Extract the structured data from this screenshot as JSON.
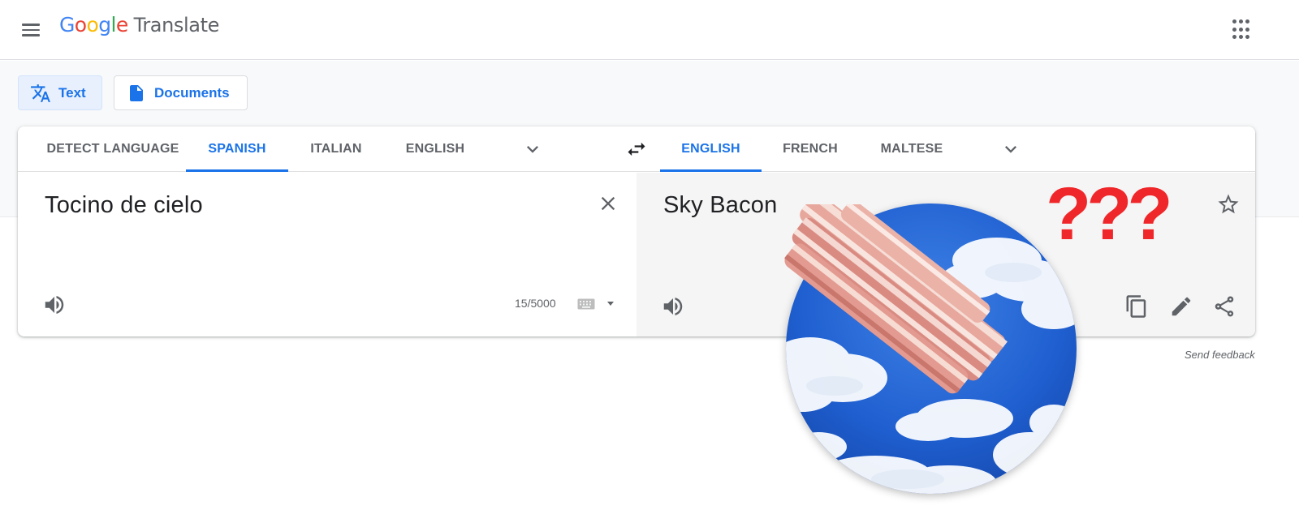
{
  "header": {
    "logo_letters": [
      "G",
      "o",
      "o",
      "g",
      "l",
      "e"
    ],
    "product_name": "Translate",
    "menu_icon": "hamburger-menu-icon",
    "apps_icon": "apps-grid-icon"
  },
  "modes": [
    {
      "label": "Text",
      "icon": "translate-icon",
      "selected": true
    },
    {
      "label": "Documents",
      "icon": "document-icon",
      "selected": false
    }
  ],
  "source_languages": [
    {
      "label": "DETECT LANGUAGE",
      "active": false
    },
    {
      "label": "SPANISH",
      "active": true
    },
    {
      "label": "ITALIAN",
      "active": false
    },
    {
      "label": "ENGLISH",
      "active": false
    }
  ],
  "target_languages": [
    {
      "label": "ENGLISH",
      "active": true
    },
    {
      "label": "FRENCH",
      "active": false
    },
    {
      "label": "MALTESE",
      "active": false
    }
  ],
  "source": {
    "text": "Tocino de cielo",
    "char_count": "15/5000"
  },
  "target": {
    "text": "Sky Bacon"
  },
  "feedback_link": "Send feedback",
  "overlay": {
    "question_marks": "???",
    "image": "bacon-in-sky-circle"
  },
  "colors": {
    "accent": "#1a73e8",
    "question_marks": "#f0272a",
    "sky": "#1f5fd0"
  }
}
